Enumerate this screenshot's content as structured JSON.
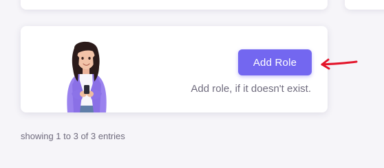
{
  "add_role_card": {
    "button_label": "Add Role",
    "hint": "Add role, if it doesn't exist.",
    "button_color": "#7367f0",
    "illustration_icon": "person-with-phone-illustration"
  },
  "annotation": {
    "arrow_color": "#e3142a",
    "arrow_icon": "red-arrow-icon"
  },
  "table_footer": {
    "entries": "showing 1 to 3 of 3 entries"
  }
}
